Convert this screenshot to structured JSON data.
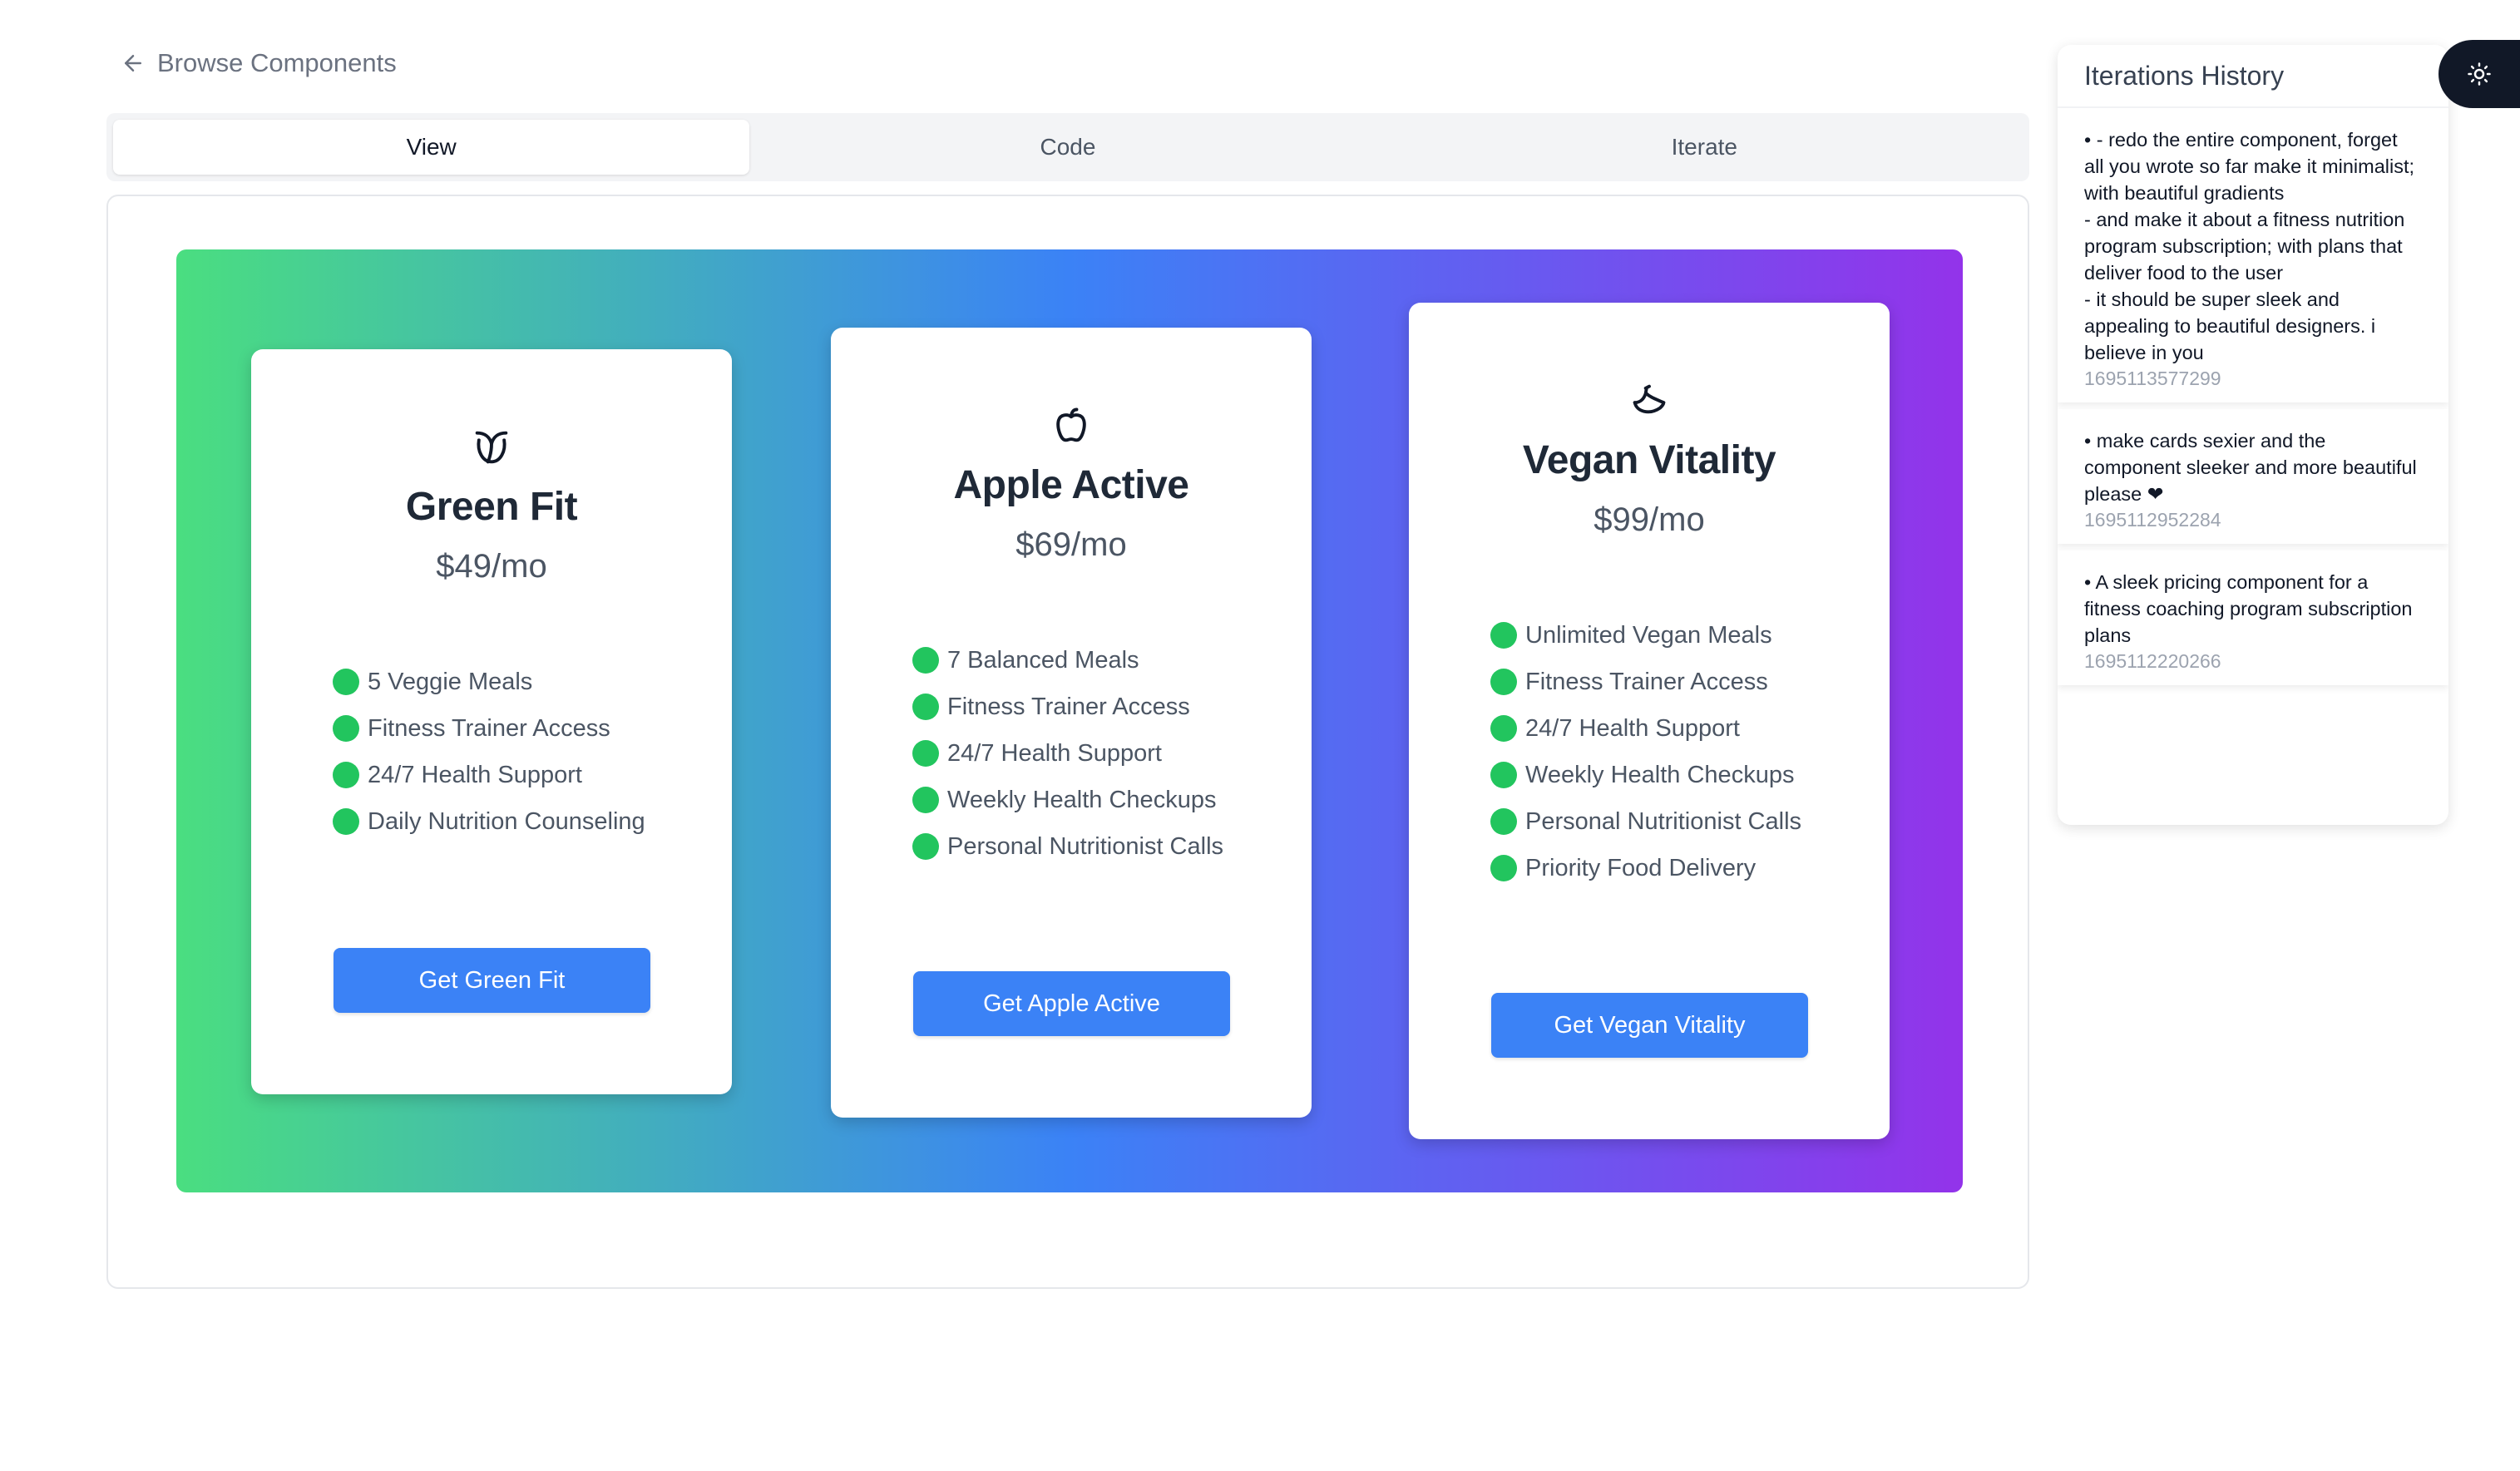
{
  "nav": {
    "back_label": "Browse Components"
  },
  "tabs": [
    {
      "label": "View",
      "active": true
    },
    {
      "label": "Code",
      "active": false
    },
    {
      "label": "Iterate",
      "active": false
    }
  ],
  "plans": [
    {
      "icon": "vegan-leaf-icon",
      "name": "Green Fit",
      "price": "$49/mo",
      "features": [
        "5 Veggie Meals",
        "Fitness Trainer Access",
        "24/7 Health Support",
        "Daily Nutrition Counseling"
      ],
      "cta": "Get Green Fit"
    },
    {
      "icon": "apple-icon",
      "name": "Apple Active",
      "price": "$69/mo",
      "features": [
        "7 Balanced Meals",
        "Fitness Trainer Access",
        "24/7 Health Support",
        "Weekly Health Checkups",
        "Personal Nutritionist Calls"
      ],
      "cta": "Get Apple Active"
    },
    {
      "icon": "banana-icon",
      "name": "Vegan Vitality",
      "price": "$99/mo",
      "features": [
        "Unlimited Vegan Meals",
        "Fitness Trainer Access",
        "24/7 Health Support",
        "Weekly Health Checkups",
        "Personal Nutritionist Calls",
        "Priority Food Delivery"
      ],
      "cta": "Get Vegan Vitality"
    }
  ],
  "history": {
    "title": "Iterations History",
    "items": [
      {
        "message": "• - redo the entire component, forget all you wrote so far make it minimalist; with beautiful gradients\n- and make it about a fitness nutrition program subscription; with plans that deliver food to the user\n- it should be super sleek and appealing to beautiful designers. i believe in you",
        "timestamp": "1695113577299"
      },
      {
        "message": "• make cards sexier and the component sleeker and more beautiful please ❤",
        "timestamp": "1695112952284"
      },
      {
        "message": "• A sleek pricing component for a fitness coaching program subscription plans",
        "timestamp": "1695112220266"
      }
    ]
  },
  "theme_toggle": {
    "icon": "sun-icon"
  },
  "colors": {
    "gradient_start": "#4ade80",
    "gradient_mid": "#3b82f6",
    "gradient_end": "#9333ea",
    "button": "#3b82f6",
    "check_dot": "#22c55e"
  }
}
